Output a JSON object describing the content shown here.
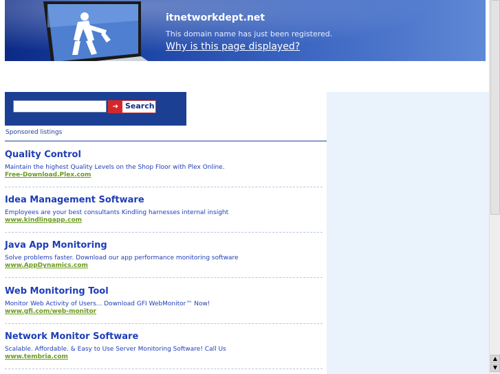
{
  "banner": {
    "domain": "itnetworkdept.net",
    "registered_text": "This domain name has just been registered.",
    "why_link": "Why is this page displayed?"
  },
  "search": {
    "button_label": "Search",
    "value": ""
  },
  "sponsored_label": "Sponsored listings",
  "listings": [
    {
      "title": "Quality Control",
      "description": "Maintain the highest Quality Levels on the Shop Floor with Plex Online.",
      "url": "Free-Download.Plex.com"
    },
    {
      "title": "Idea Management Software",
      "description": "Employees are your best consultants Kindling harnesses internal insight",
      "url": "www.kindlingapp.com"
    },
    {
      "title": "Java App Monitoring",
      "description": "Solve problems faster. Download our app performance monitoring software",
      "url": "www.AppDynamics.com"
    },
    {
      "title": "Web Monitoring Tool",
      "description": "Monitor Web Activity of Users... Download GFI WebMonitor™ Now!",
      "url": "www.gfi.com/web-monitor"
    },
    {
      "title": "Network Monitor Software",
      "description": "Scalable. Affordable. & Easy to Use Server Monitoring Software! Call Us",
      "url": "www.tembria.com"
    }
  ],
  "icons": {
    "laptop": "laptop-construction-icon",
    "search_arrow": "arrow-right-icon",
    "scroll_up": "scroll-up-icon",
    "scroll_down": "scroll-down-icon"
  },
  "colors": {
    "banner_dark": "#0c2a86",
    "banner_light": "#5f88d6",
    "link_blue": "#1d3db7",
    "url_green": "#6b9a21",
    "search_red": "#d7262b",
    "panel_bg": "#eaf2fb"
  }
}
